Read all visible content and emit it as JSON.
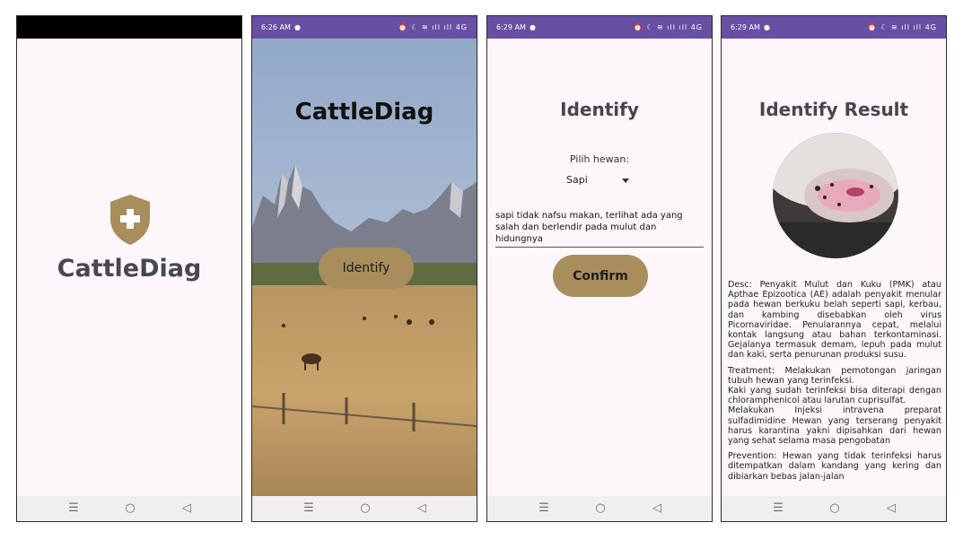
{
  "screen1": {
    "app_name": "CattleDiag",
    "logo_icon": "shield-plus-icon"
  },
  "screen2": {
    "time": "6:26 AM",
    "title": "CattleDiag",
    "identify_label": "Identify"
  },
  "screen3": {
    "time": "6:29 AM",
    "title": "Identify",
    "pick_label": "Pilih hewan:",
    "selected_animal": "Sapi",
    "symptom_text": "sapi tidak nafsu makan, terlihat ada yang salah dan berlendir pada mulut dan hidungnya",
    "confirm_label": "Confirm"
  },
  "screen4": {
    "time": "6:29 AM",
    "title": "Identify Result",
    "desc": "Desc: Penyakit Mulut dan Kuku (PMK) atau Apthae Epizootica (AE) adalah penyakit menular pada hewan berkuku belah seperti sapi, kerbau, dan kambing disebabkan oleh virus Picornaviridae. Penularannya cepat, melalui kontak langsung atau bahan terkontaminasi. Gejalanya termasuk demam, lepuh pada mulut dan kaki, serta penurunan produksi susu.",
    "treatment_1": "Treatment: Melakukan pemotongan jaringan tubuh hewan yang terinfeksi.",
    "treatment_2": "Kaki yang sudah terinfeksi bisa diterapi dengan chloramphenicol atau larutan cuprisulfat.",
    "treatment_3": "Melakukan Injeksi intravena preparat sulfadimidine Hewan yang terserang penyakit harus karantina yakni dipisahkan dari hewan yang sehat selama masa pengobatan",
    "prevention": "Prevention: Hewan yang tidak terinfeksi harus ditempatkan dalam kandang yang kering dan dibiarkan bebas jalan-jalan"
  },
  "nav": {
    "menu": "☰",
    "home": "○",
    "back": "◁"
  },
  "status_icons": "⏰ ☾ ≋ ıll ıll 4G",
  "colors": {
    "status_bar": "#6750a4",
    "accent_button": "#a88e5c",
    "background": "#fdf7fc"
  }
}
